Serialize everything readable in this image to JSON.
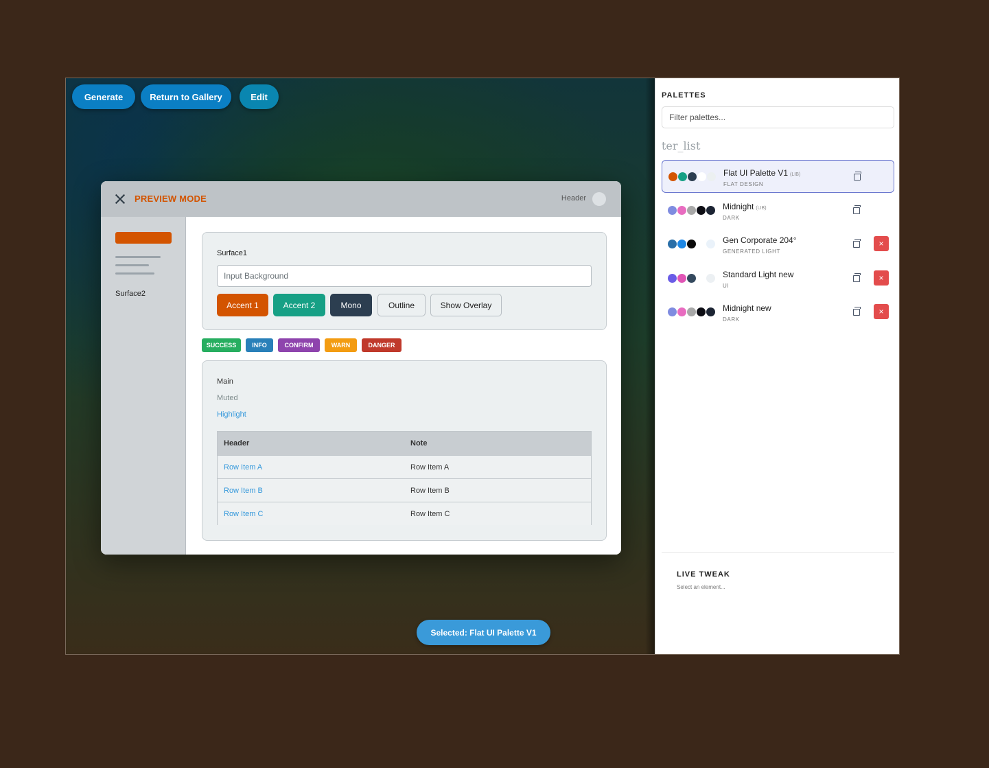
{
  "toolbar": {
    "generate_label": "Generate",
    "gallery_label": "Return to Gallery",
    "edit_label": "Edit"
  },
  "modal": {
    "title": "PREVIEW MODE",
    "header_label": "Header",
    "side_label": "Surface2",
    "surface1_label": "Surface1",
    "input_placeholder": "Input Background",
    "buttons": {
      "accent1": "Accent 1",
      "accent2": "Accent 2",
      "mono": "Mono",
      "outline": "Outline",
      "overlay": "Show Overlay"
    },
    "badges": {
      "success": "SUCCESS",
      "info": "INFO",
      "confirm": "CONFIRM",
      "warn": "WARN",
      "danger": "DANGER"
    },
    "text": {
      "main": "Main",
      "muted": "Muted",
      "highlight": "Highlight"
    },
    "table": {
      "headers": [
        "Header",
        "Note"
      ],
      "rows": [
        [
          "Row Item A",
          "Row Item A"
        ],
        [
          "Row Item B",
          "Row Item B"
        ],
        [
          "Row Item C",
          "Row Item C"
        ]
      ]
    }
  },
  "toast": "Selected: Flat UI Palette V1",
  "panel": {
    "title": "PALETTES",
    "filter_placeholder": "Filter palettes...",
    "ghost_text": "ter_list",
    "palettes": [
      {
        "name": "Flat UI Palette V1",
        "tag": "(LIB)",
        "category": "FLAT DESIGN",
        "selected": true,
        "deletable": false,
        "swatches": [
          "#d35400",
          "#16a085",
          "#2c3e50",
          "#ffffff",
          "#ecf0f1"
        ]
      },
      {
        "name": "Midnight",
        "tag": "(LIB)",
        "category": "DARK",
        "selected": false,
        "deletable": false,
        "swatches": [
          "#7f8ce0",
          "#e86cc0",
          "#a8a8a8",
          "#0d0d14",
          "#1c2433"
        ]
      },
      {
        "name": "Gen Corporate 204°",
        "tag": "",
        "category": "GENERATED LIGHT",
        "selected": false,
        "deletable": true,
        "swatches": [
          "#2a6fa8",
          "#1e88e5",
          "#0a0a0a",
          "#ffffff",
          "#eaf2fa"
        ]
      },
      {
        "name": "Standard Light new",
        "tag": "",
        "category": "UI",
        "selected": false,
        "deletable": true,
        "swatches": [
          "#6a5ce6",
          "#e055b5",
          "#34495e",
          "#ffffff",
          "#ecf0f3"
        ]
      },
      {
        "name": "Midnight new",
        "tag": "",
        "category": "DARK",
        "selected": false,
        "deletable": true,
        "swatches": [
          "#7f8ce0",
          "#e86cc0",
          "#a8a8a8",
          "#0d0d14",
          "#1c2433"
        ]
      }
    ],
    "delete_glyph": "×",
    "live_tweak_title": "LIVE TWEAK",
    "live_tweak_hint": "Select an element..."
  },
  "colors": {
    "accent1": "#d35400",
    "accent2": "#16a085",
    "mono": "#2c3e50",
    "toolbar_button": "#0b7fc4",
    "edit_button": "#0a86b0",
    "success": "#27ae60",
    "info": "#2980b9",
    "confirm": "#8e44ad",
    "warn": "#f39c12",
    "danger": "#c0392b",
    "highlight": "#3498db",
    "delete": "#e34c4c"
  }
}
